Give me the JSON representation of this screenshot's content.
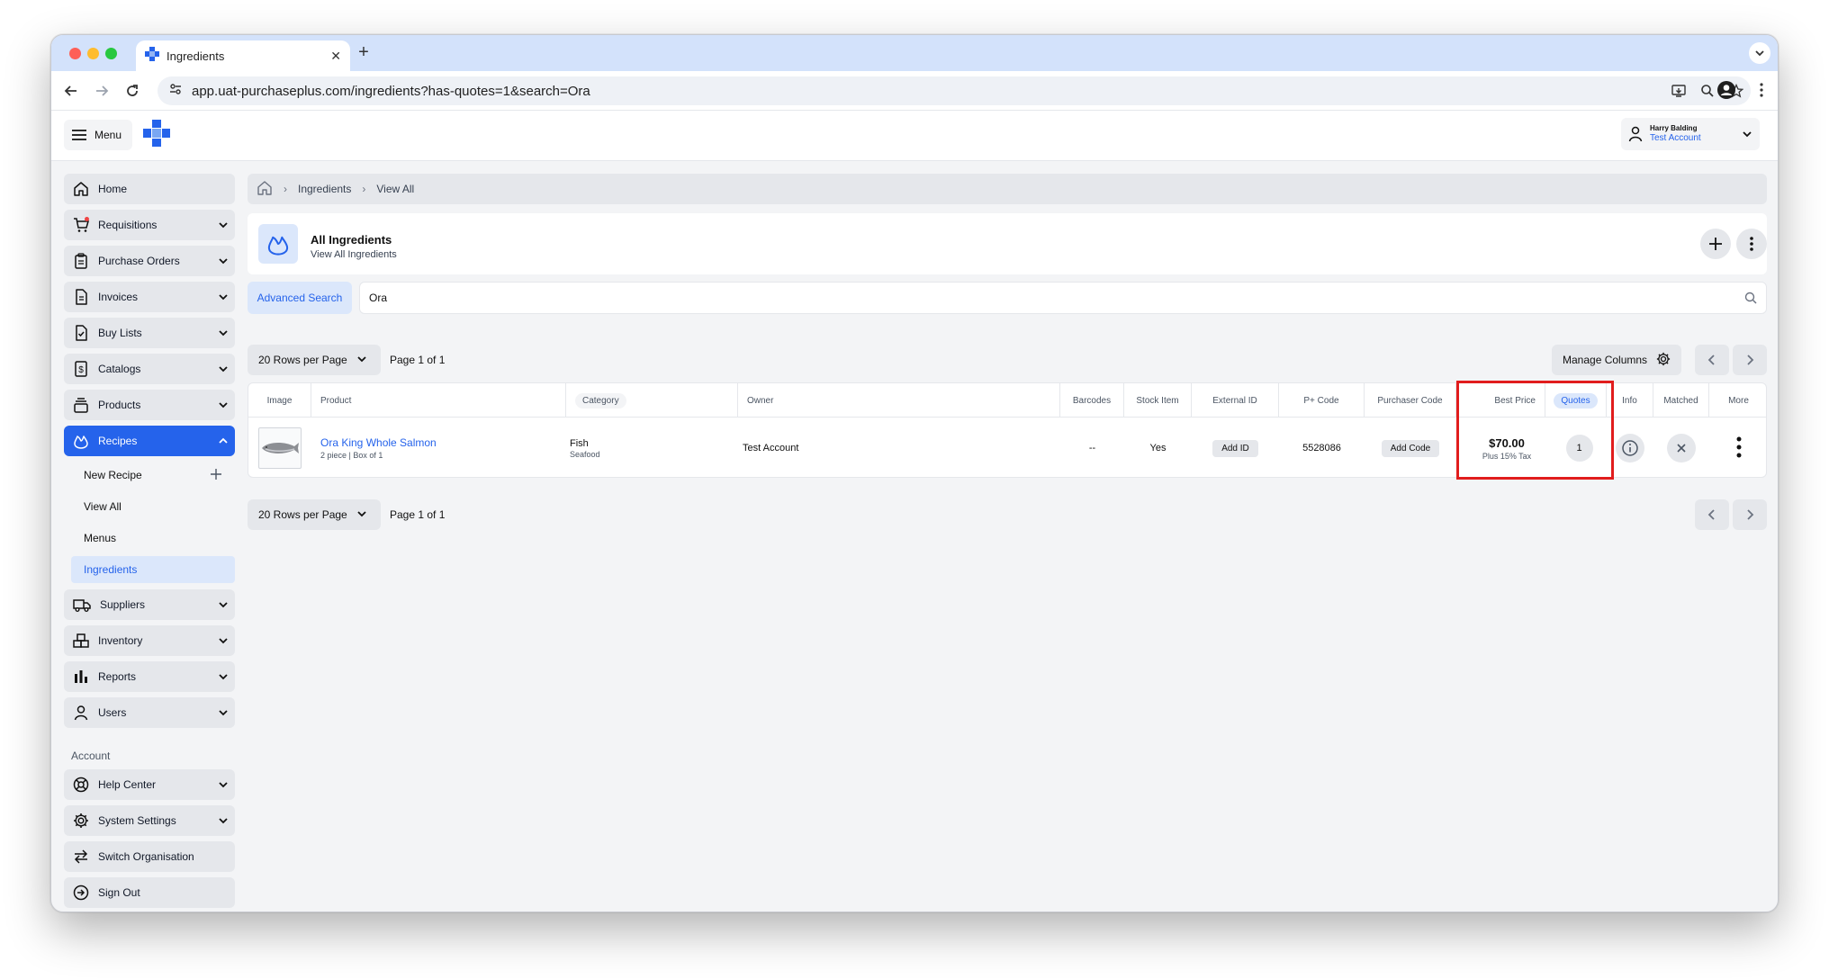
{
  "browser": {
    "tab_title": "Ingredients",
    "url": "app.uat-purchaseplus.com/ingredients?has-quotes=1&search=Ora"
  },
  "header": {
    "menu_label": "Menu",
    "user_name": "Harry Balding",
    "user_account": "Test Account"
  },
  "sidebar": {
    "items": [
      {
        "label": "Home",
        "icon": "home-icon"
      },
      {
        "label": "Requisitions",
        "icon": "cart-icon"
      },
      {
        "label": "Purchase Orders",
        "icon": "clipboard-icon"
      },
      {
        "label": "Invoices",
        "icon": "document-icon"
      },
      {
        "label": "Buy Lists",
        "icon": "checklist-icon"
      },
      {
        "label": "Catalogs",
        "icon": "dollar-document-icon"
      },
      {
        "label": "Products",
        "icon": "box-stack-icon"
      },
      {
        "label": "Recipes",
        "icon": "flame-icon"
      },
      {
        "label": "Suppliers",
        "icon": "truck-icon"
      },
      {
        "label": "Inventory",
        "icon": "boxes-icon"
      },
      {
        "label": "Reports",
        "icon": "bar-chart-icon"
      },
      {
        "label": "Users",
        "icon": "user-icon"
      }
    ],
    "recipes_sub": [
      "New Recipe",
      "View All",
      "Menus",
      "Ingredients"
    ],
    "account_label": "Account",
    "account_items": [
      {
        "label": "Help Center",
        "icon": "lifebuoy-icon"
      },
      {
        "label": "System Settings",
        "icon": "gear-icon"
      },
      {
        "label": "Switch Organisation",
        "icon": "swap-icon"
      },
      {
        "label": "Sign Out",
        "icon": "sign-out-icon"
      }
    ]
  },
  "breadcrumb": {
    "items": [
      "Ingredients",
      "View All"
    ]
  },
  "page_header": {
    "title": "All Ingredients",
    "subtitle": "View All Ingredients"
  },
  "search": {
    "advanced_label": "Advanced Search",
    "value": "Ora"
  },
  "pagination": {
    "rows_label": "20 Rows per Page",
    "page_info": "Page 1 of 1",
    "manage_columns": "Manage Columns"
  },
  "table": {
    "headers": {
      "image": "Image",
      "product": "Product",
      "category": "Category",
      "owner": "Owner",
      "barcodes": "Barcodes",
      "stock_item": "Stock Item",
      "external_id": "External ID",
      "p_code": "P+ Code",
      "purchaser_code": "Purchaser Code",
      "best_price": "Best Price",
      "quotes": "Quotes",
      "info": "Info",
      "matched": "Matched",
      "more": "More"
    },
    "rows": [
      {
        "product_name": "Ora King Whole Salmon",
        "product_sub": "2 piece | Box of 1",
        "category": "Fish",
        "subcategory": "Seafood",
        "owner": "Test Account",
        "barcodes": "--",
        "stock_item": "Yes",
        "external_id_btn": "Add ID",
        "p_code": "5528086",
        "purchaser_code_btn": "Add Code",
        "best_price": "$70.00",
        "tax_note": "Plus 15% Tax",
        "quotes": "1"
      }
    ]
  }
}
